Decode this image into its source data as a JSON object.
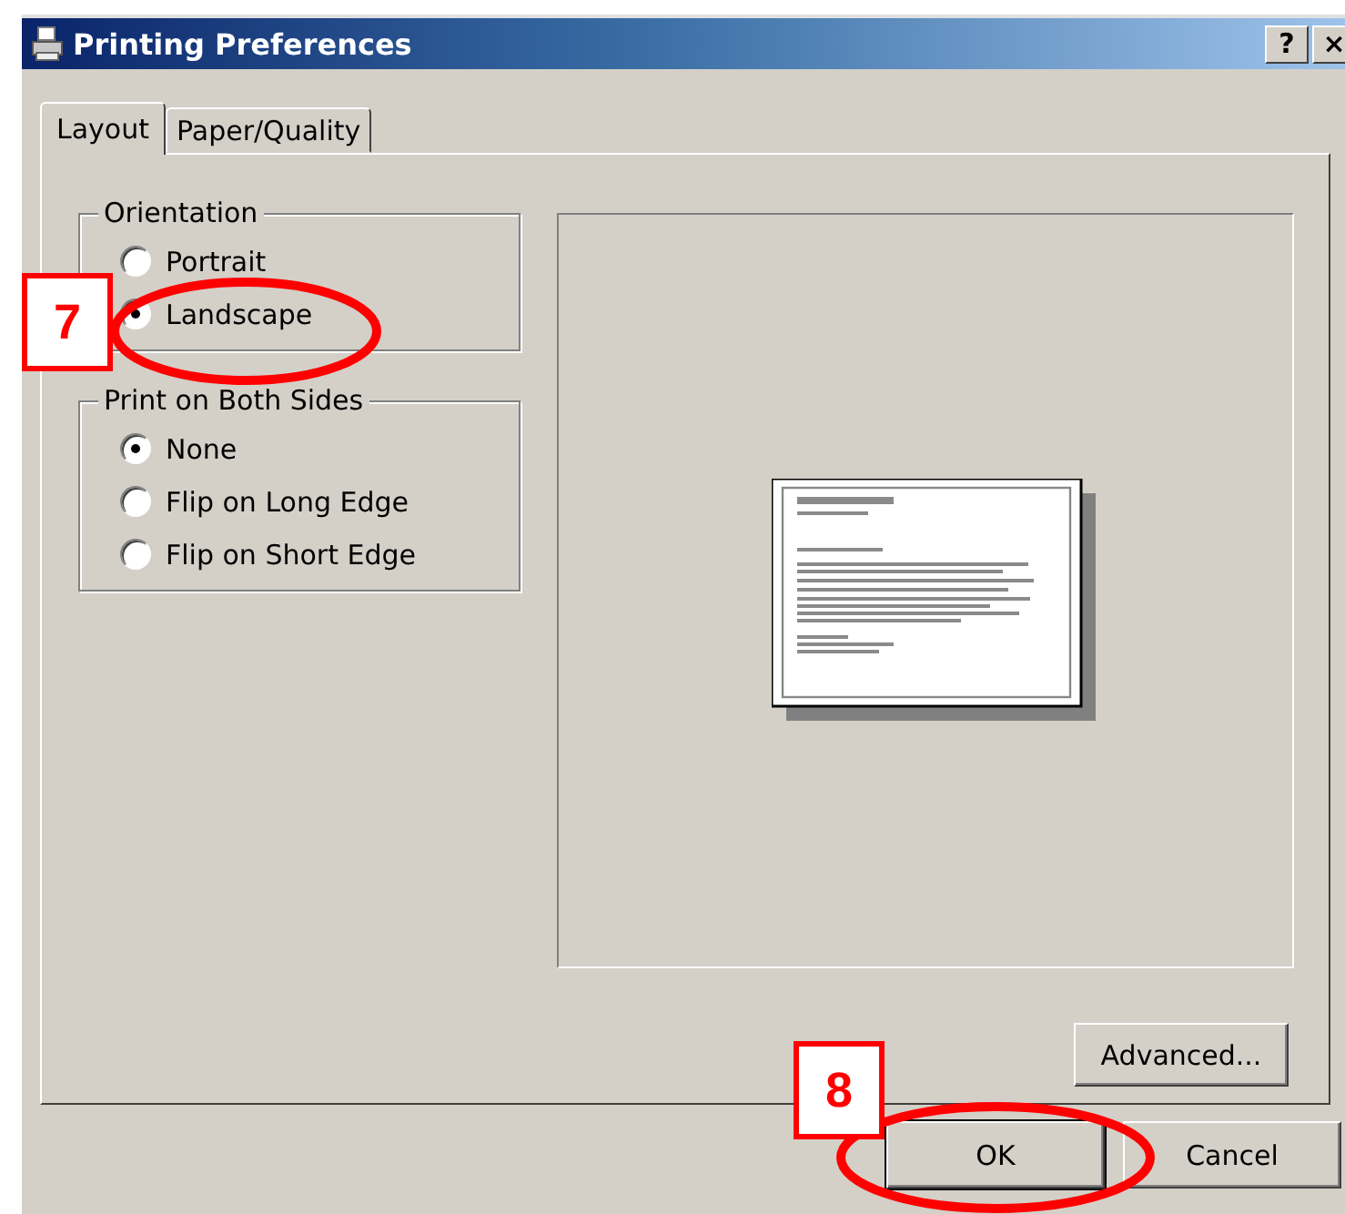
{
  "window": {
    "title": "Printing Preferences",
    "help_button": "?",
    "close_button": "×"
  },
  "tabs": [
    {
      "label": "Layout",
      "selected": true
    },
    {
      "label": "Paper/Quality",
      "selected": false
    }
  ],
  "groups": [
    {
      "title": "Orientation",
      "options": [
        {
          "label": "Portrait",
          "selected": false
        },
        {
          "label": "Landscape",
          "selected": true
        }
      ]
    },
    {
      "title": "Print on Both Sides",
      "options": [
        {
          "label": "None",
          "selected": true
        },
        {
          "label": "Flip on Long Edge",
          "selected": false
        },
        {
          "label": "Flip on Short Edge",
          "selected": false
        }
      ]
    }
  ],
  "advanced_button": "Advanced...",
  "buttons": [
    "OK",
    "Cancel"
  ],
  "annotations": [
    {
      "label": "7"
    },
    {
      "label": "8"
    }
  ]
}
